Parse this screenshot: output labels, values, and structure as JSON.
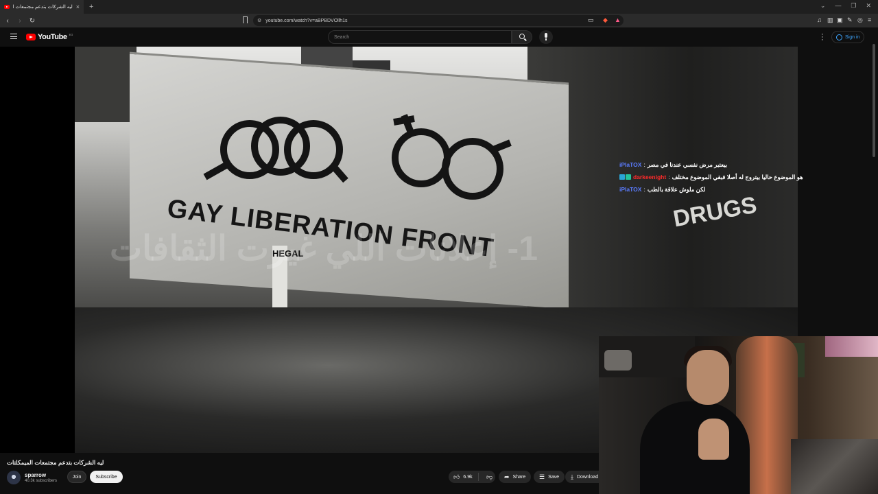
{
  "browser": {
    "tab_title": "ليه الشركات بتدعم مجتمعات الميس...",
    "tab_close": "×",
    "new_tab": "+",
    "url": "youtube.com/watch?v=aBPBDVOllh1s",
    "window_controls": [
      "⌄",
      "—",
      "❐",
      "✕"
    ]
  },
  "youtube": {
    "logo_text": "YouTube",
    "logo_country": "EG",
    "search_placeholder": "Search",
    "sign_in": "Sign in"
  },
  "video": {
    "banner_text": "GAY LIBERATION FRONT",
    "watermark": "1- إعلانات اللي غيرت الثقافات",
    "sign_drugs": "DRUGS",
    "sign_legal": "HEGAL"
  },
  "chat": [
    {
      "user": "iPlaTOX",
      "user_color": "#5b7cff",
      "message": "بيعتبر مرض نفسي عندنا في مصر",
      "badges": []
    },
    {
      "user": "darkeenight",
      "user_color": "#ff2a2a",
      "message": "هو الموضوع حاليا بيتروج له أصلا فبقي الموضوع مختلف",
      "badges": [
        "#2aa6d6",
        "#23c49a"
      ]
    },
    {
      "user": "iPlaTOX",
      "user_color": "#5b7cff",
      "message": "لكن ملوش علاقة بالطب",
      "badges": []
    }
  ],
  "chat_separator": ":",
  "below": {
    "title": "ليه الشركات بتدعم مجتمعات الميمكلتات",
    "channel": "sparrow",
    "subscribers": "40.3k subscribers",
    "join": "Join",
    "subscribe": "Subscribe",
    "likes": "6.9k",
    "share": "Share",
    "save": "Save",
    "download": "Download"
  }
}
